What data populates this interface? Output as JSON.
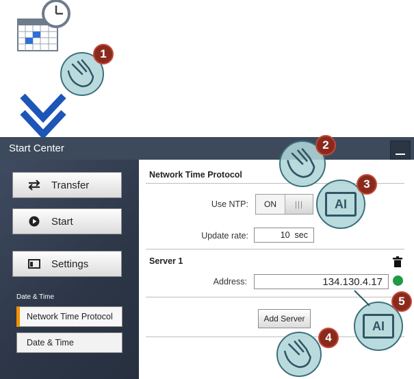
{
  "window": {
    "title": "Start Center"
  },
  "sidebar": {
    "buttons": [
      {
        "label": "Transfer",
        "icon": "transfer-icon"
      },
      {
        "label": "Start",
        "icon": "play-icon"
      },
      {
        "label": "Settings",
        "icon": "settings-icon"
      }
    ],
    "section_label": "Date & Time",
    "nav": [
      {
        "label": "Network Time Protocol",
        "active": true
      },
      {
        "label": "Date & Time",
        "active": false
      }
    ]
  },
  "main": {
    "section_title": "Network Time Protocol",
    "use_ntp": {
      "label": "Use NTP:",
      "value": "ON",
      "knob": "|||"
    },
    "update_rate": {
      "label": "Update rate:",
      "value": "10",
      "unit": "sec"
    },
    "server": {
      "title": "Server 1",
      "address_label": "Address:",
      "address_value": "134.130.4.17",
      "status_color": "#1f9a45"
    },
    "add_server_label": "Add Server"
  },
  "callouts": {
    "steps": [
      "1",
      "2",
      "3",
      "4",
      "5"
    ],
    "keyboard_text": "AI",
    "badge_color": "#8a2a1c"
  }
}
